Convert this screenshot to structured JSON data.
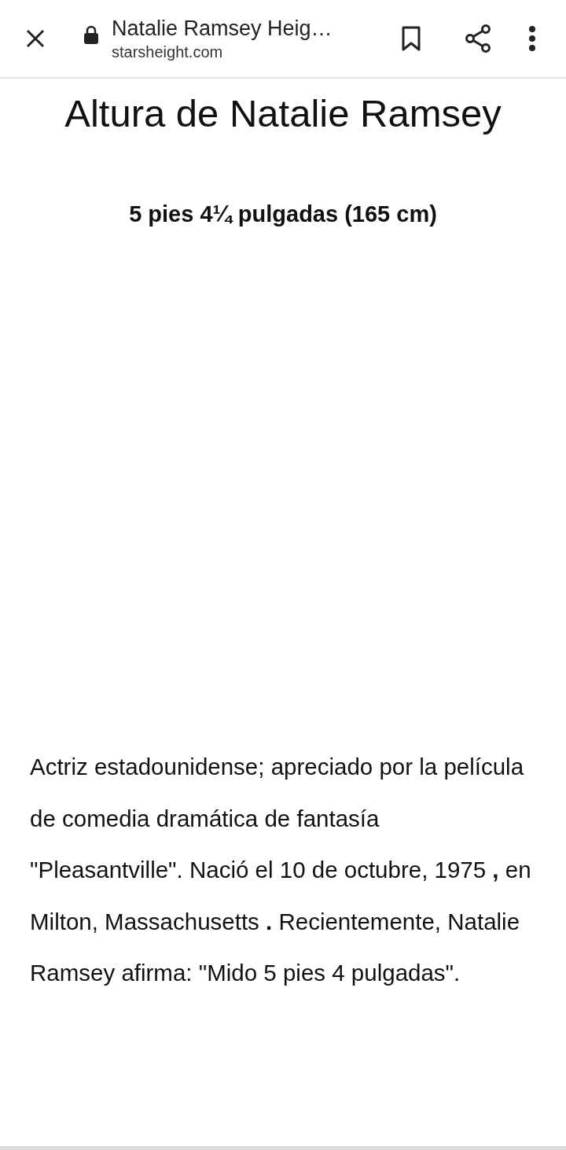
{
  "toolbar": {
    "title": "Natalie Ramsey Heig…",
    "url": "starsheight.com"
  },
  "article": {
    "heading": "Altura de Natalie Ramsey",
    "height": "5 pies 4¼ pulgadas (165 cm)",
    "paragraph": "Actriz estadounidense; apreciado por la película de comedia dramática de fantasía \"Pleasantville\". Nació el 10 de octubre, 1975 **,** en Milton, Massachusetts **.** Recientemente, Natalie Ramsey afirma: \"Mido 5 pies 4 pulgadas\"."
  }
}
